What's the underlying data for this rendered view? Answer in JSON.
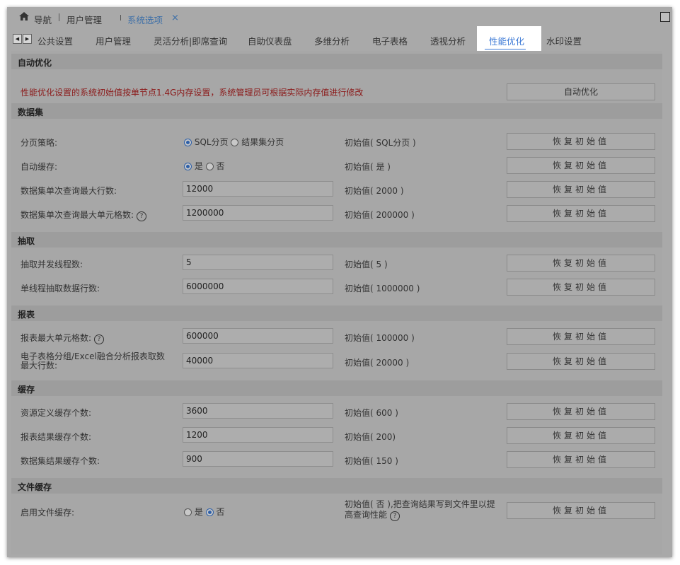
{
  "breadcrumb": {
    "home_label": "导航",
    "item1": "用户管理",
    "active": "系统选项",
    "close": "×"
  },
  "tabs": [
    {
      "label": "公共设置"
    },
    {
      "label": "用户管理"
    },
    {
      "label": "灵活分析|即席查询"
    },
    {
      "label": "自助仪表盘"
    },
    {
      "label": "多维分析"
    },
    {
      "label": "电子表格"
    },
    {
      "label": "透视分析"
    },
    {
      "label": "性能优化",
      "active": true
    },
    {
      "label": "水印设置"
    }
  ],
  "icons": {
    "home": "home-icon",
    "maximize": "maximize-icon",
    "scroll_left": "arrow-left-icon",
    "scroll_right": "arrow-right-icon",
    "help": "help-icon"
  },
  "colors": {
    "accent": "#3d7ad6",
    "warning": "#8b1a1a"
  },
  "sections": {
    "auto": {
      "title": "自动优化",
      "warning": "性能优化设置的系统初始值按单节点1.4G内存设置，系统管理员可根据实际内存值进行修改",
      "button": "自动优化"
    },
    "dataset": {
      "title": "数据集",
      "rows": [
        {
          "label": "分页策略:",
          "options": [
            "SQL分页",
            "结果集分页"
          ],
          "selected": 0,
          "initial": "初始值( SQL分页 )",
          "button": "恢复初始值"
        },
        {
          "label": "自动缓存:",
          "options": [
            "是",
            "否"
          ],
          "selected": 0,
          "initial": "初始值( 是 )",
          "button": "恢复初始值"
        },
        {
          "label": "数据集单次查询最大行数:",
          "value": "12000",
          "initial": "初始值( 2000 )",
          "button": "恢复初始值"
        },
        {
          "label": "数据集单次查询最大单元格数:",
          "value": "1200000",
          "initial": "初始值( 200000 )",
          "button": "恢复初始值"
        }
      ]
    },
    "extract": {
      "title": "抽取",
      "rows": [
        {
          "label": "抽取并发线程数:",
          "value": "5",
          "initial": "初始值( 5 )",
          "button": "恢复初始值"
        },
        {
          "label": "单线程抽取数据行数:",
          "value": "6000000",
          "initial": "初始值( 1000000 )",
          "button": "恢复初始值"
        }
      ]
    },
    "report": {
      "title": "报表",
      "rows": [
        {
          "label": "报表最大单元格数:",
          "value": "600000",
          "initial": "初始值( 100000 )",
          "button": "恢复初始值"
        },
        {
          "label": "电子表格分组/Excel融合分析报表取数最大行数:",
          "value": "40000",
          "initial": "初始值( 20000 )",
          "button": "恢复初始值"
        }
      ]
    },
    "cache": {
      "title": "缓存",
      "rows": [
        {
          "label": "资源定义缓存个数:",
          "value": "3600",
          "initial": "初始值( 600 )",
          "button": "恢复初始值"
        },
        {
          "label": "报表结果缓存个数:",
          "value": "1200",
          "initial": "初始值( 200)",
          "button": "恢复初始值"
        },
        {
          "label": "数据集结果缓存个数:",
          "value": "900",
          "initial": "初始值( 150 )",
          "button": "恢复初始值"
        }
      ]
    },
    "filecache": {
      "title": "文件缓存",
      "rows": [
        {
          "label": "启用文件缓存:",
          "options": [
            "是",
            "否"
          ],
          "selected": 1,
          "initial": "初始值( 否 ),把查询结果写到文件里以提高查询性能",
          "button": "恢复初始值"
        }
      ]
    }
  }
}
